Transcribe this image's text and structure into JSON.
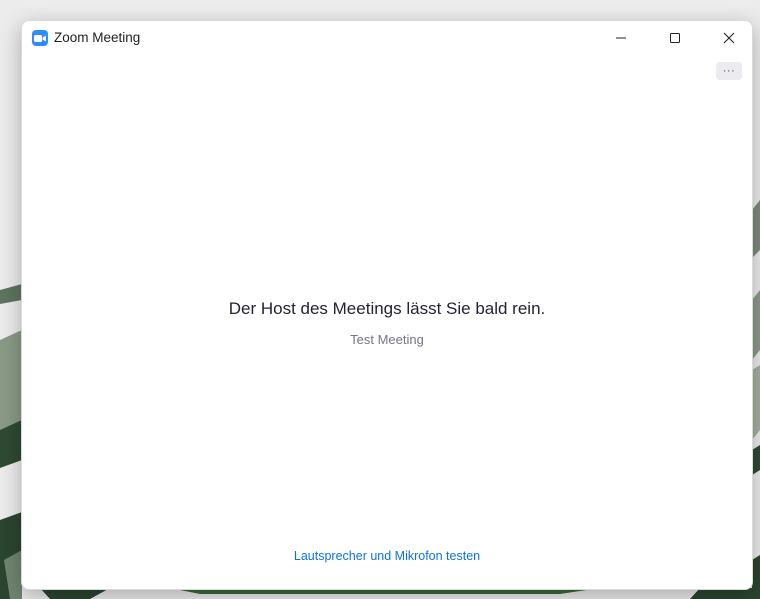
{
  "window": {
    "title": "Zoom Meeting",
    "app_icon": "zoom-camera-icon"
  },
  "titlebar_controls": {
    "minimize_icon": "minimize-icon",
    "maximize_icon": "maximize-icon",
    "close_icon": "close-icon"
  },
  "toolbar": {
    "more_label": "···"
  },
  "content": {
    "waiting_message": "Der Host des Meetings lässt Sie bald rein.",
    "meeting_name": "Test Meeting",
    "test_audio_link": "Lautsprecher und Mikrofon testen"
  },
  "colors": {
    "accent": "#0e71eb",
    "zoom_blue": "#2d8cff",
    "desktop_plants": "#3a5a3a"
  }
}
